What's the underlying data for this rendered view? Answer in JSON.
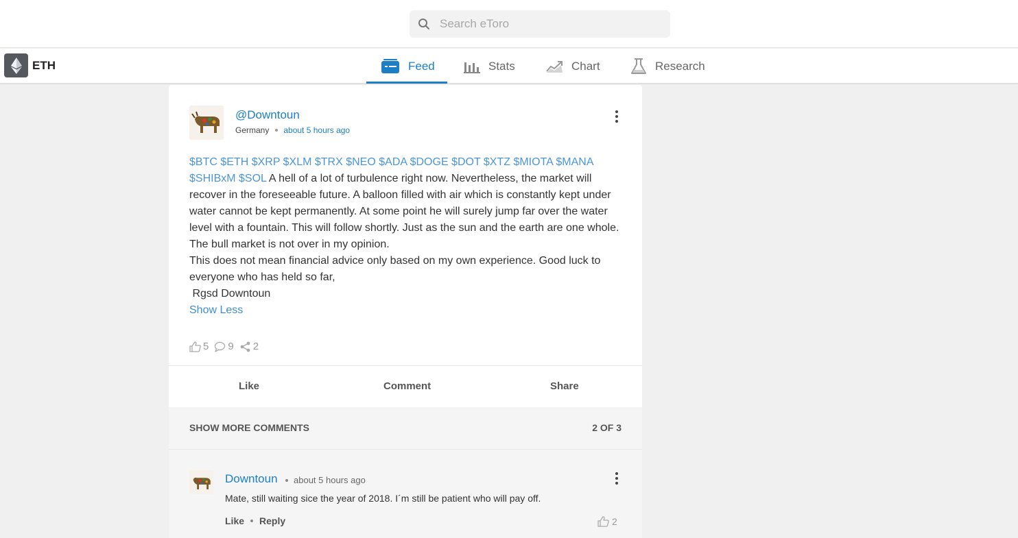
{
  "search": {
    "placeholder": "Search eToro"
  },
  "instrument": {
    "symbol": "ETH"
  },
  "tabs": [
    {
      "label": "Feed",
      "icon": "feed-icon",
      "active": true
    },
    {
      "label": "Stats",
      "icon": "bar-chart-icon",
      "active": false
    },
    {
      "label": "Chart",
      "icon": "line-chart-icon",
      "active": false
    },
    {
      "label": "Research",
      "icon": "flask-icon",
      "active": false
    }
  ],
  "post": {
    "author": "@Downtoun",
    "country": "Germany",
    "time": "about 5 hours ago",
    "tags": "$BTC $ETH $XRP $XLM $TRX $NEO $ADA $DOGE $DOT $XTZ $MIOTA $MANA $SHIBxM $SOL",
    "text_1": " A hell of a lot of turbulence right now. Nevertheless, the market will recover in the foreseeable future. A balloon filled with air which is constantly kept under water cannot be kept permanently. At some point he will surely jump far over the water level with a fountain. This will follow shortly. Just as the sun and the earth are one whole. The bull market is not over in my opinion.",
    "text_2": "This does not mean financial advice only based on my own experience. Good luck to everyone who has held so far,",
    "text_3": " Rgsd Downtoun",
    "show_less": "Show Less",
    "likes": "5",
    "comments": "9",
    "shares": "2",
    "actions": {
      "like": "Like",
      "comment": "Comment",
      "share": "Share"
    }
  },
  "comments_header": {
    "label": "SHOW MORE COMMENTS",
    "count": "2 OF 3"
  },
  "comment": {
    "author": "Downtoun",
    "time": "about 5 hours ago",
    "text": "Mate, still waiting sice the year of 2018. I´m still be patient who will pay off.",
    "like": "Like",
    "reply": "Reply",
    "likes": "2"
  },
  "colors": {
    "accent": "#1c7fc6",
    "link": "#4a95d8",
    "background": "#f0f0f0"
  }
}
